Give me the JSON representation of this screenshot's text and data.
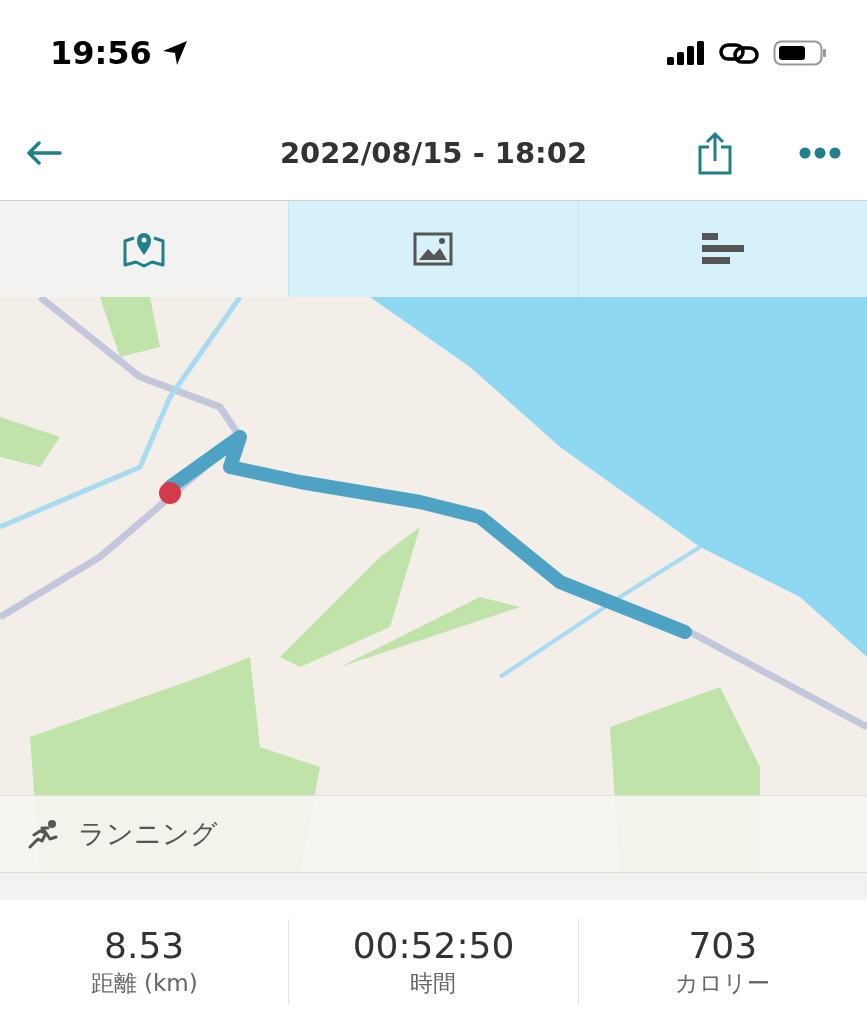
{
  "status_bar": {
    "time": "19:56"
  },
  "header": {
    "title": "2022/08/15 - 18:02"
  },
  "tabs": [
    {
      "selected": true
    },
    {
      "selected": false
    },
    {
      "selected": false
    }
  ],
  "activity": {
    "label": "ランニング"
  },
  "stats": [
    {
      "value": "8.53",
      "label": "距離 (km)"
    },
    {
      "value": "00:52:50",
      "label": "時間"
    },
    {
      "value": "703",
      "label": "カロリー"
    }
  ]
}
